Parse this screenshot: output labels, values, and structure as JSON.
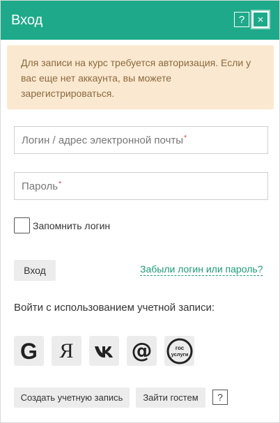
{
  "header": {
    "title": "Вход",
    "help_label": "?",
    "close_label": "×",
    "color": "#1eaa8a"
  },
  "alert": {
    "text": "Для записи на курс требуется авторизация. Если у вас еще нет аккаунта, вы можете зарегистрироваться."
  },
  "form": {
    "login_placeholder": "Логин / адрес электронной почты",
    "password_placeholder": "Пароль",
    "required_mark": "*",
    "remember_label": "Запомнить логин",
    "login_button": "Вход",
    "forgot_link": "Забыли логин или пароль?"
  },
  "oauth": {
    "title": "Войти с использованием учетной записи:",
    "providers": [
      {
        "name": "google",
        "glyph": "G",
        "icon": "google-icon"
      },
      {
        "name": "yandex",
        "glyph": "Я",
        "icon": "yandex-icon"
      },
      {
        "name": "vk",
        "glyph": "vk",
        "icon": "vk-icon"
      },
      {
        "name": "mailru",
        "glyph": "@",
        "icon": "mailru-icon"
      },
      {
        "name": "gosuslugi",
        "glyph_top": "гос",
        "glyph_bottom": "услуги",
        "icon": "gosuslugi-icon"
      }
    ]
  },
  "footer": {
    "create_account": "Создать учетную запись",
    "guest": "Зайти гостем",
    "help_label": "?"
  }
}
